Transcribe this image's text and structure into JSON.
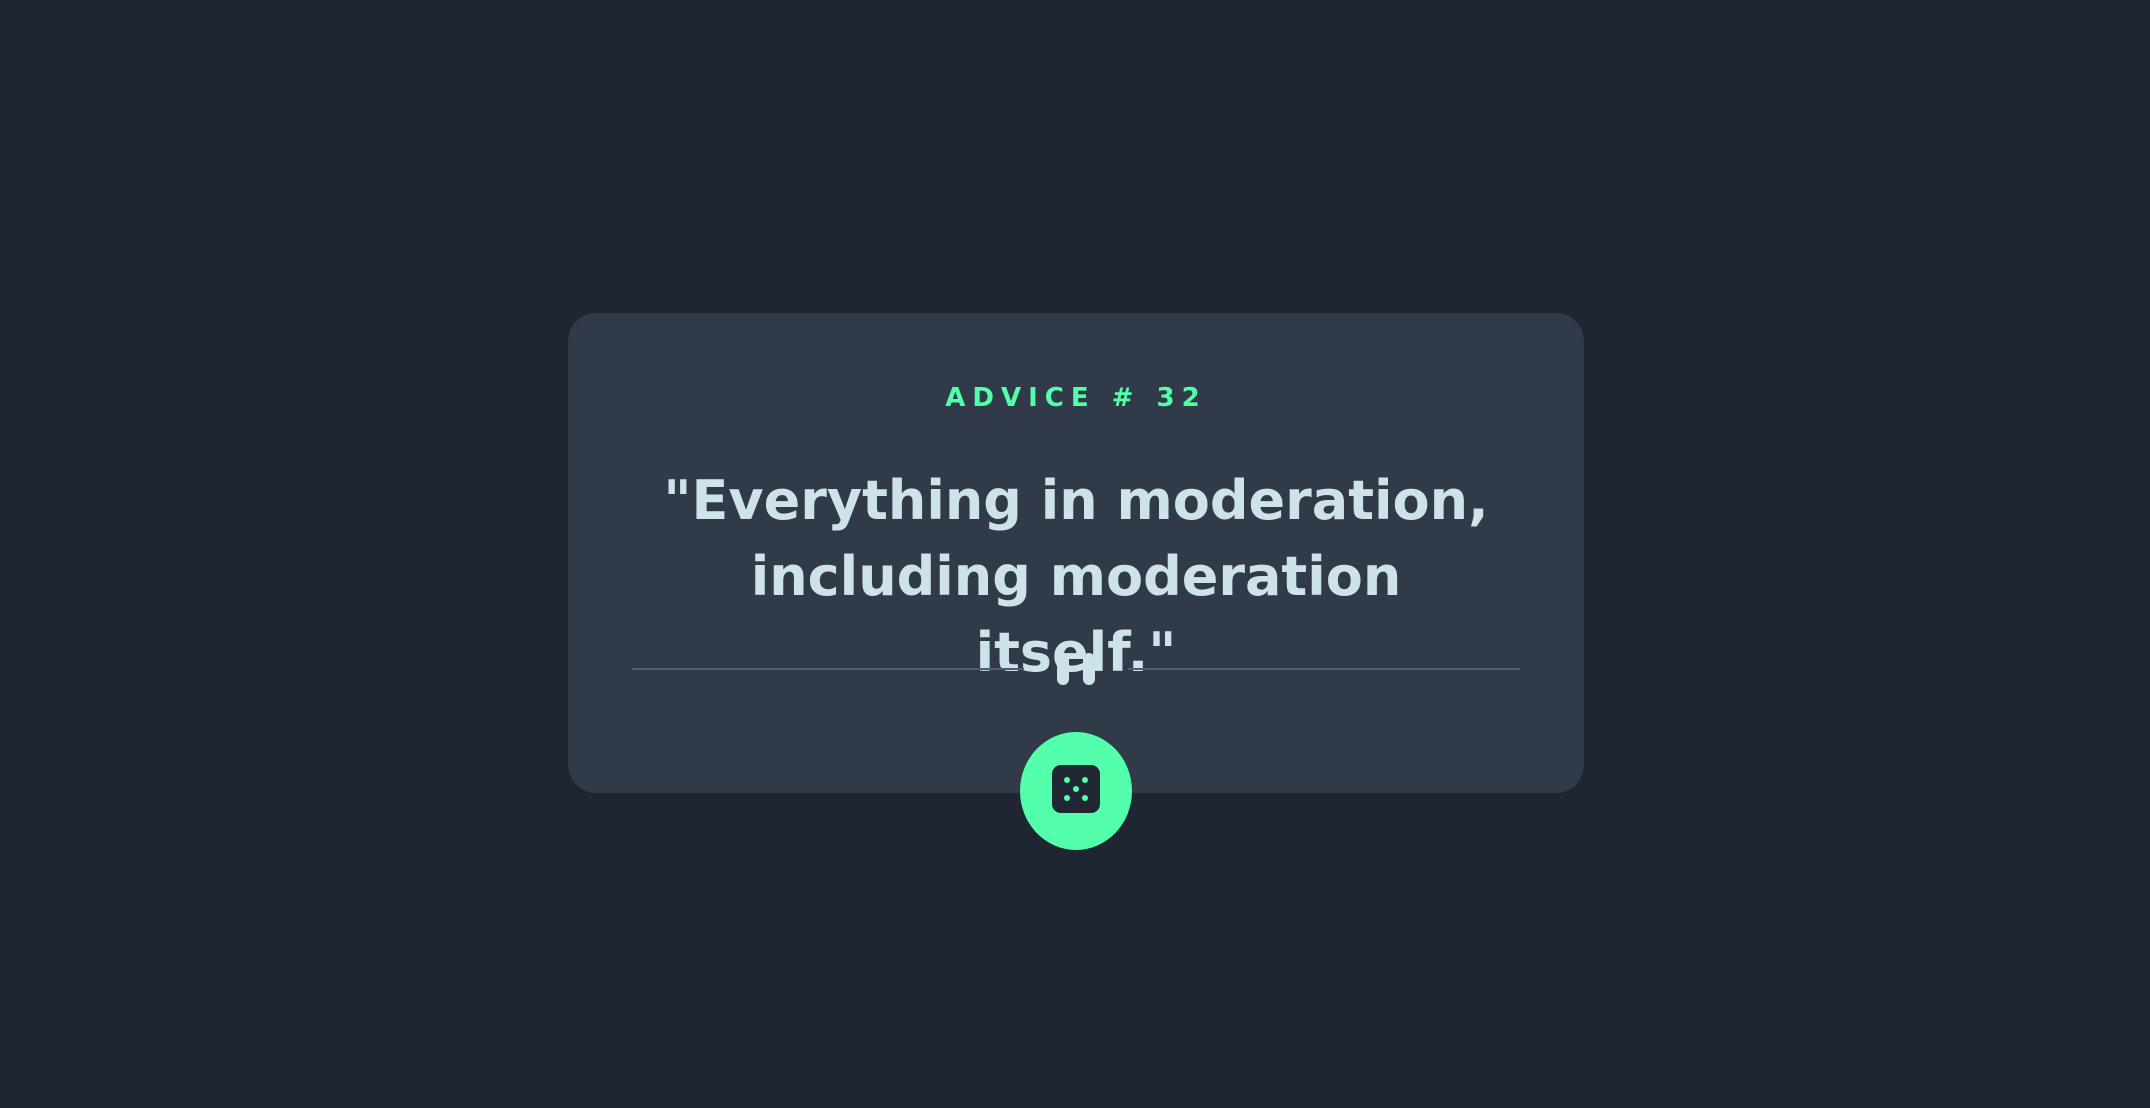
{
  "advice": {
    "id_label": "ADVICE # 32",
    "quote": "\"Everything in moderation, including moderation itself.\""
  },
  "icons": {
    "divider": "pause-icon",
    "button": "dice-icon"
  },
  "colors": {
    "background": "#1f2632",
    "card": "#313a48",
    "accent": "#53ffaa",
    "text": "#cee3e9",
    "divider": "#4f5d74"
  }
}
